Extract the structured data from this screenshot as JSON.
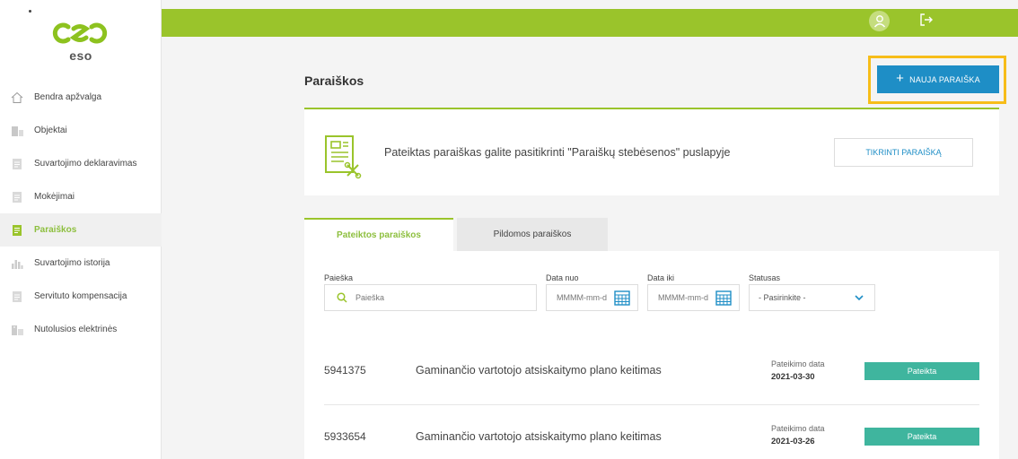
{
  "sidebar": {
    "logo_text": "eso",
    "items": [
      {
        "label": "Bendra apžvalga",
        "icon": "home-icon"
      },
      {
        "label": "Objektai",
        "icon": "building-icon"
      },
      {
        "label": "Suvartojimo deklaravimas",
        "icon": "document-icon"
      },
      {
        "label": "Mokėjimai",
        "icon": "document-icon"
      },
      {
        "label": "Paraiškos",
        "icon": "form-icon",
        "active": true
      },
      {
        "label": "Suvartojimo istorija",
        "icon": "bar-chart-icon"
      },
      {
        "label": "Servituto kompensacija",
        "icon": "document-icon"
      },
      {
        "label": "Nutolusios elektrinės",
        "icon": "power-plant-icon"
      }
    ]
  },
  "topbar": {
    "user_icon": "user-icon",
    "logout_icon": "logout-icon",
    "color": "#9ac42b"
  },
  "page": {
    "title": "Paraiškos",
    "new_button_label": "NAUJA PARAIŠKA",
    "new_button_plus": "+",
    "highlight_color": "#f7bd19"
  },
  "info": {
    "text": "Pateiktas paraiškas galite pasitikrinti \"Paraiškų stebėsenos\" puslapyje",
    "check_button_label": "TIKRINTI PARAIŠKĄ"
  },
  "tabs": [
    {
      "label": "Pateiktos paraiškos",
      "active": true
    },
    {
      "label": "Pildomos paraiškos",
      "active": false
    }
  ],
  "filters": {
    "search_label": "Paieška",
    "search_placeholder": "Paieška",
    "date_from_label": "Data nuo",
    "date_from_placeholder": "MMMM-mm-d",
    "date_to_label": "Data iki",
    "date_to_placeholder": "MMMM-mm-d",
    "status_label": "Statusas",
    "status_value": "- Pasirinkite -"
  },
  "applications": [
    {
      "number": "5941375",
      "title": "Gaminančio vartotojo atsiskaitymo plano keitimas",
      "date_label": "Pateikimo data",
      "date": "2021-03-30",
      "status": "Pateikta"
    },
    {
      "number": "5933654",
      "title": "Gaminančio vartotojo atsiskaitymo plano keitimas",
      "date_label": "Pateikimo data",
      "date": "2021-03-26",
      "status": "Pateikta"
    }
  ],
  "colors": {
    "accent_green": "#9ac42b",
    "primary_blue": "#1e8ec6",
    "status_teal": "#3fb59e"
  }
}
